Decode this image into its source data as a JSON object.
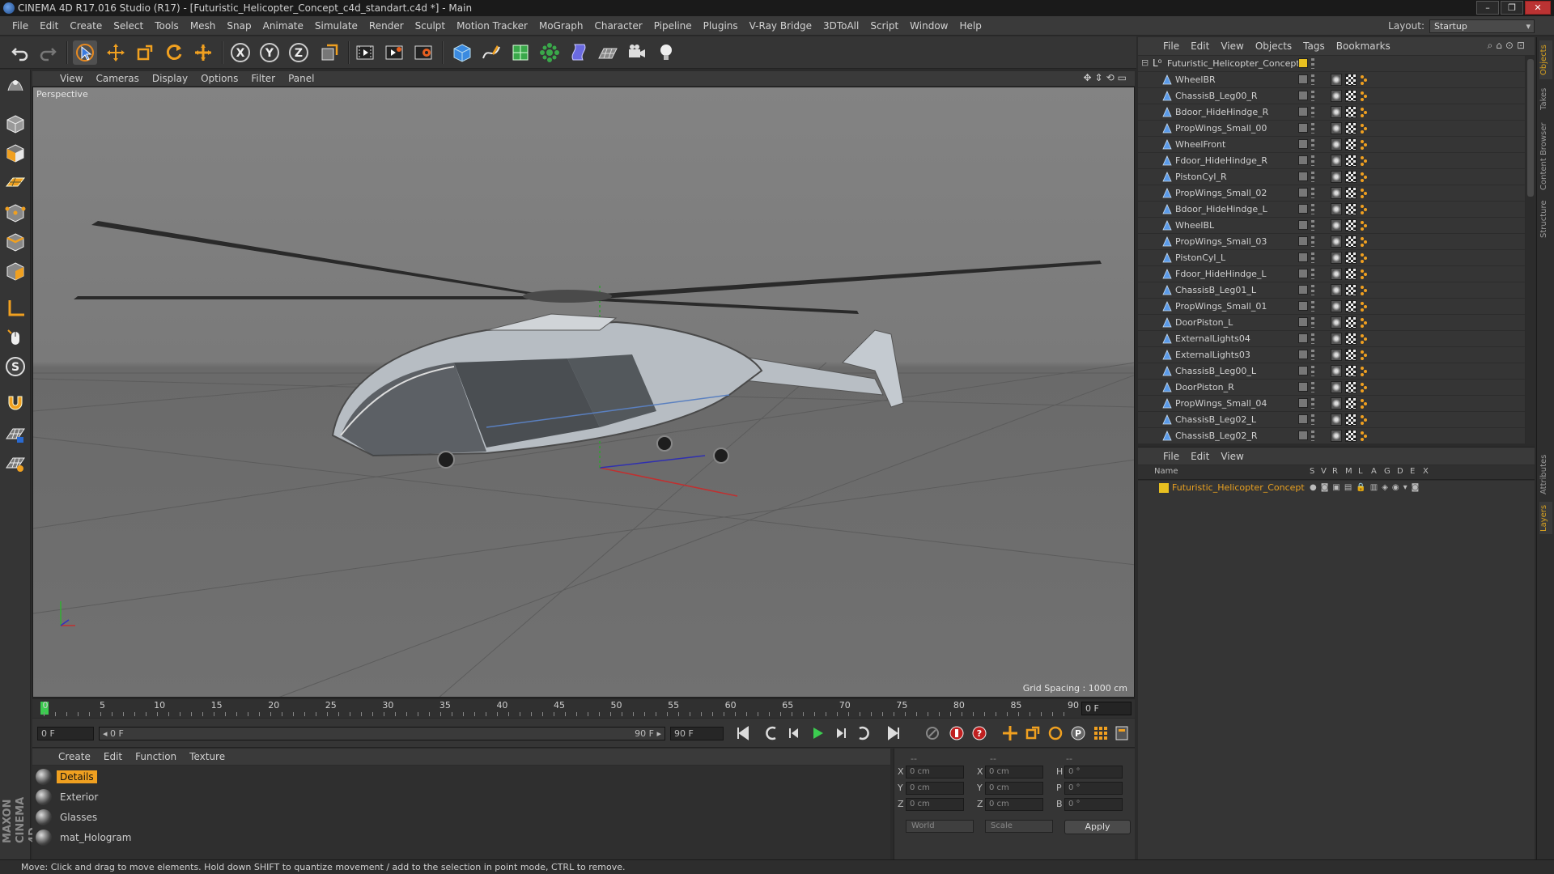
{
  "window": {
    "title": "CINEMA 4D R17.016 Studio (R17) - [Futuristic_Helicopter_Concept_c4d_standart.c4d *] - Main",
    "buttons": {
      "min": "–",
      "max": "❐",
      "close": "✕"
    }
  },
  "menubar": {
    "items": [
      "File",
      "Edit",
      "Create",
      "Select",
      "Tools",
      "Mesh",
      "Snap",
      "Animate",
      "Simulate",
      "Render",
      "Sculpt",
      "Motion Tracker",
      "MoGraph",
      "Character",
      "Pipeline",
      "Plugins",
      "V-Ray Bridge",
      "3DToAll",
      "Script",
      "Window",
      "Help"
    ],
    "layout_label": "Layout:",
    "layout_value": "Startup"
  },
  "toolbar": {
    "icons": [
      "undo-icon",
      "redo-icon",
      "select-arrow-icon",
      "move-icon",
      "scale-icon",
      "rotate-icon",
      "live-select-icon",
      "x-axis-icon",
      "y-axis-icon",
      "z-axis-icon",
      "coordinate-system-icon",
      "render-view-icon",
      "render-picture-viewer-icon",
      "render-settings-icon",
      "cube-icon",
      "pen-spline-icon",
      "subdivision-icon",
      "array-icon",
      "deformer-icon",
      "floor-icon",
      "camera-icon",
      "light-icon"
    ],
    "axis_labels": {
      "x": "X",
      "y": "Y",
      "z": "Z"
    }
  },
  "lefttools": {
    "icons": [
      "make-editable-icon",
      "model-mode-icon",
      "texture-mode-icon",
      "workplane-icon",
      "points-mode-icon",
      "edges-mode-icon",
      "polygons-mode-icon",
      "axis-mode-icon",
      "tweak-mode-icon",
      "snap-icon",
      "magnet-icon",
      "grid-snap-icon",
      "lock-grid-icon"
    ],
    "snap_letter": "S",
    "logo": "MAXON CINEMA 4D"
  },
  "viewport": {
    "menu": [
      "View",
      "Cameras",
      "Display",
      "Options",
      "Filter",
      "Panel"
    ],
    "label": "Perspective",
    "grid_spacing": "Grid Spacing : 1000 cm"
  },
  "timeline": {
    "ticks": [
      "0",
      "5",
      "10",
      "15",
      "20",
      "25",
      "30",
      "35",
      "40",
      "45",
      "50",
      "55",
      "60",
      "65",
      "70",
      "75",
      "80",
      "85",
      "90"
    ],
    "current_frame": "0 F"
  },
  "transport": {
    "start_field": "0 F",
    "range_left": "◂ 0 F",
    "range_right": "90 F ▸",
    "end_field": "90 F"
  },
  "materials": {
    "menu": [
      "Create",
      "Edit",
      "Function",
      "Texture"
    ],
    "items": [
      {
        "name": "Details",
        "selected": true
      },
      {
        "name": "Exterior",
        "selected": false
      },
      {
        "name": "Glasses",
        "selected": false
      },
      {
        "name": "mat_Hologram",
        "selected": false
      }
    ]
  },
  "coords": {
    "header_left": "--",
    "header_mid": "--",
    "header_right": "--",
    "rows": [
      {
        "a": "X",
        "av": "0 cm",
        "b": "X",
        "bv": "0 cm",
        "c": "H",
        "cv": "0 °"
      },
      {
        "a": "Y",
        "av": "0 cm",
        "b": "Y",
        "bv": "0 cm",
        "c": "P",
        "cv": "0 °"
      },
      {
        "a": "Z",
        "av": "0 cm",
        "b": "Z",
        "bv": "0 cm",
        "c": "B",
        "cv": "0 °"
      }
    ],
    "space": "World",
    "mode": "Scale",
    "apply": "Apply"
  },
  "object_manager": {
    "menu": [
      "File",
      "Edit",
      "View",
      "Objects",
      "Tags",
      "Bookmarks"
    ],
    "root": "Futuristic_Helicopter_Concept",
    "objects": [
      "WheelBR",
      "ChassisB_Leg00_R",
      "Bdoor_HideHindge_R",
      "PropWings_Small_00",
      "WheelFront",
      "Fdoor_HideHindge_R",
      "PistonCyl_R",
      "PropWings_Small_02",
      "Bdoor_HideHindge_L",
      "WheelBL",
      "PropWings_Small_03",
      "PistonCyl_L",
      "Fdoor_HideHindge_L",
      "ChassisB_Leg01_L",
      "PropWings_Small_01",
      "DoorPiston_L",
      "ExternalLights04",
      "ExternalLights03",
      "ChassisB_Leg00_L",
      "DoorPiston_R",
      "PropWings_Small_04",
      "ChassisB_Leg02_L",
      "ChassisB_Leg02_R"
    ]
  },
  "layer_manager": {
    "menu": [
      "File",
      "Edit",
      "View"
    ],
    "columns": [
      "Name",
      "S",
      "V",
      "R",
      "M",
      "L",
      "A",
      "G",
      "D",
      "E",
      "X"
    ],
    "layers": [
      "Futuristic_Helicopter_Concept"
    ]
  },
  "right_tabs": [
    "Objects",
    "Takes",
    "Content Browser",
    "Structure",
    "Attributes",
    "Layers"
  ],
  "status": "Move: Click and drag to move elements. Hold down SHIFT to quantize movement / add to the selection in point mode, CTRL to remove.",
  "colors": {
    "accent": "#f0a020",
    "layer_yellow": "#e8c020",
    "link_orange": "#e8a020"
  }
}
